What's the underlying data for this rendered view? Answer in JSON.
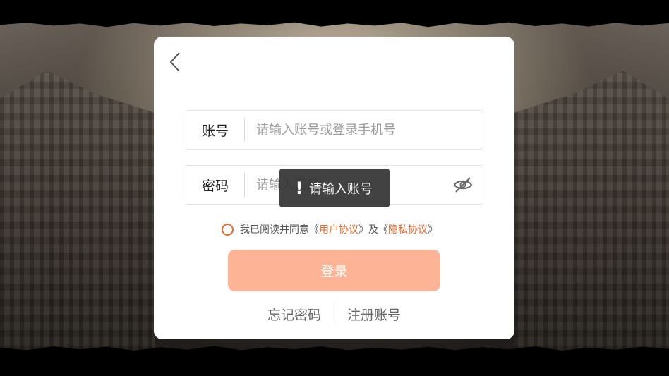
{
  "back": {
    "icon": "chevron-left-icon"
  },
  "account": {
    "label": "账号",
    "placeholder": "请输入账号或登录手机号",
    "value": ""
  },
  "password": {
    "label": "密码",
    "placeholder": "请输入密码",
    "value": "",
    "toggle_icon": "eye-off-icon"
  },
  "agreement": {
    "prefix": "我已阅读并同意",
    "open1": "《",
    "user_agreement": "用户协议",
    "close1": "》",
    "and": "及",
    "open2": "《",
    "privacy_agreement": "隐私协议",
    "close2": "》",
    "checked": false
  },
  "login_button": "登录",
  "links": {
    "forgot": "忘记密码",
    "register": "注册账号"
  },
  "toast": {
    "icon": "exclamation-icon",
    "message": "请输入账号"
  },
  "colors": {
    "accent": "#e76a2e",
    "login_button_disabled": "#fdb496",
    "dialog": "#ffffff",
    "toast_bg": "#323232"
  }
}
